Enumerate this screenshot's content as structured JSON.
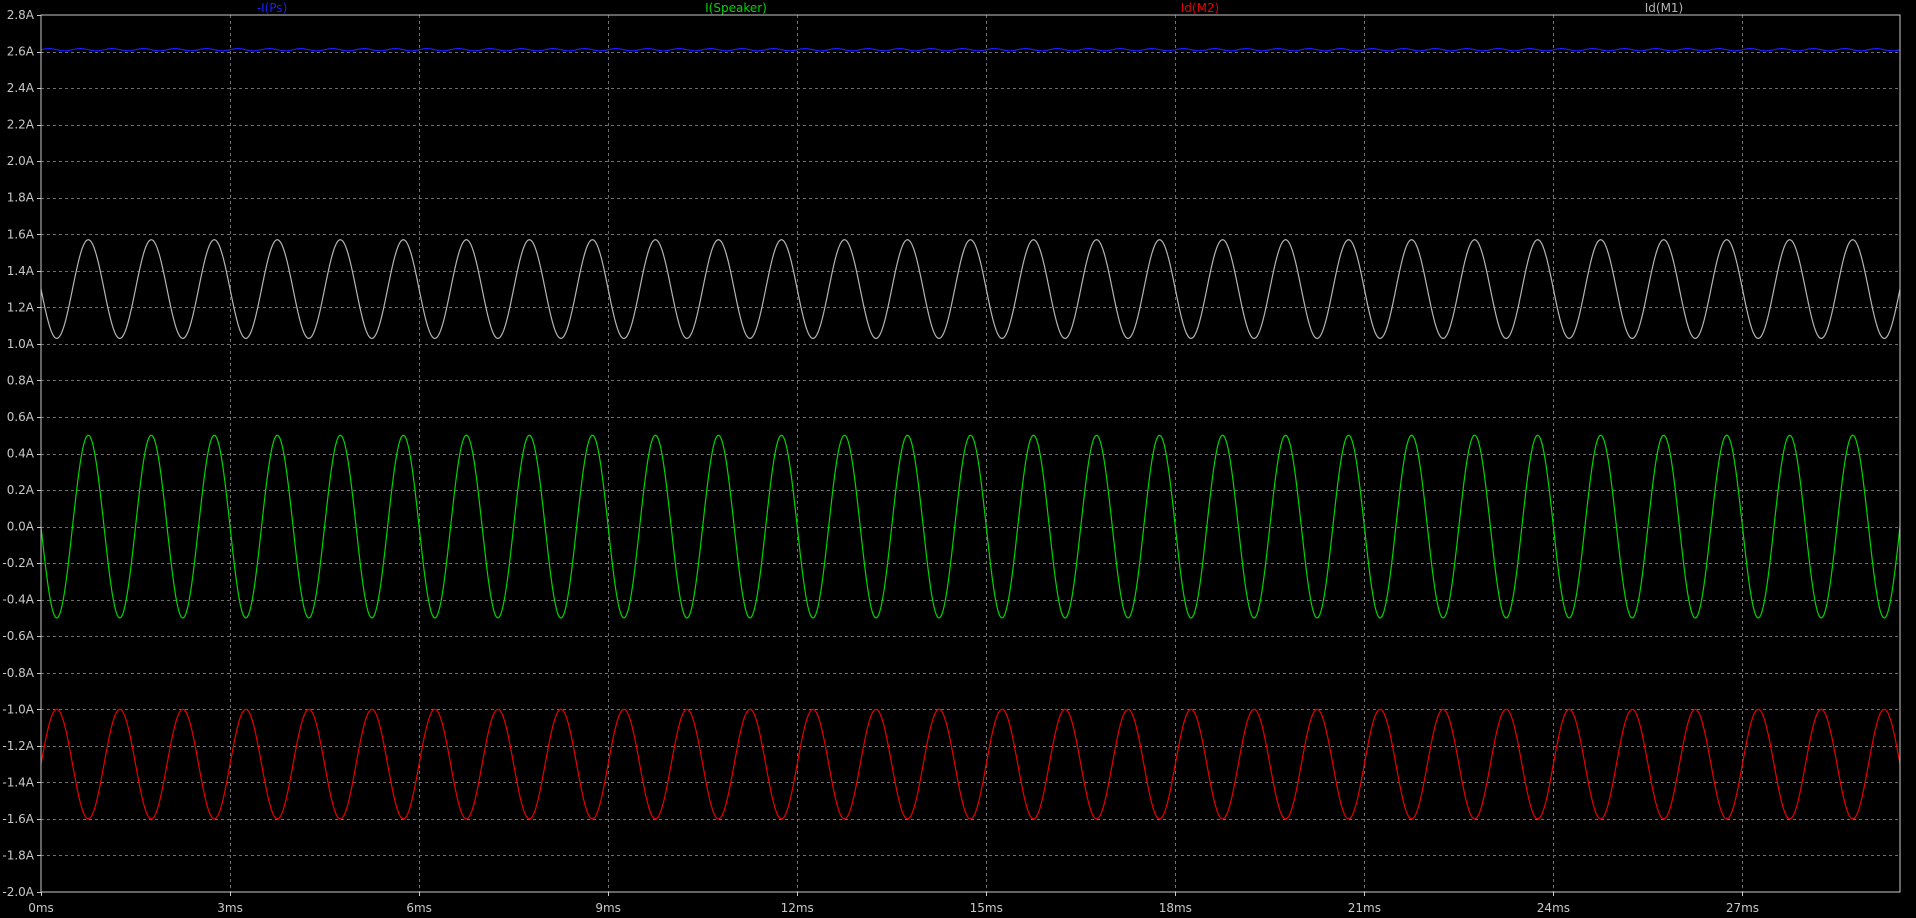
{
  "chart_data": {
    "type": "line",
    "title": "",
    "xlabel": "",
    "ylabel": "",
    "x_unit": "ms",
    "y_unit": "A",
    "xlim": [
      0,
      29.5
    ],
    "ylim": [
      -2.0,
      2.8
    ],
    "grid": true,
    "legend_placement": "top",
    "background_color": "#000000",
    "grid_color": "#6e6e6e",
    "axis_color": "#c8c8c8",
    "x_ticks": [
      {
        "value": 0,
        "label": "0ms"
      },
      {
        "value": 3,
        "label": "3ms"
      },
      {
        "value": 6,
        "label": "6ms"
      },
      {
        "value": 9,
        "label": "9ms"
      },
      {
        "value": 12,
        "label": "12ms"
      },
      {
        "value": 15,
        "label": "15ms"
      },
      {
        "value": 18,
        "label": "18ms"
      },
      {
        "value": 21,
        "label": "21ms"
      },
      {
        "value": 24,
        "label": "24ms"
      },
      {
        "value": 27,
        "label": "27ms"
      }
    ],
    "y_ticks": [
      {
        "value": 2.8,
        "label": "2.8A"
      },
      {
        "value": 2.6,
        "label": "2.6A"
      },
      {
        "value": 2.4,
        "label": "2.4A"
      },
      {
        "value": 2.2,
        "label": "2.2A"
      },
      {
        "value": 2.0,
        "label": "2.0A"
      },
      {
        "value": 1.8,
        "label": "1.8A"
      },
      {
        "value": 1.6,
        "label": "1.6A"
      },
      {
        "value": 1.4,
        "label": "1.4A"
      },
      {
        "value": 1.2,
        "label": "1.2A"
      },
      {
        "value": 1.0,
        "label": "1.0A"
      },
      {
        "value": 0.8,
        "label": "0.8A"
      },
      {
        "value": 0.6,
        "label": "0.6A"
      },
      {
        "value": 0.4,
        "label": "0.4A"
      },
      {
        "value": 0.2,
        "label": "0.2A"
      },
      {
        "value": 0.0,
        "label": "0.0A"
      },
      {
        "value": -0.2,
        "label": "-0.2A"
      },
      {
        "value": -0.4,
        "label": "-0.4A"
      },
      {
        "value": -0.6,
        "label": "-0.6A"
      },
      {
        "value": -0.8,
        "label": "-0.8A"
      },
      {
        "value": -1.0,
        "label": "-1.0A"
      },
      {
        "value": -1.2,
        "label": "-1.2A"
      },
      {
        "value": -1.4,
        "label": "-1.4A"
      },
      {
        "value": -1.6,
        "label": "-1.6A"
      },
      {
        "value": -1.8,
        "label": "-1.8A"
      },
      {
        "value": -2.0,
        "label": "-2.0A"
      }
    ],
    "series": [
      {
        "name": "-I(Ps)",
        "color": "#1e1eff",
        "waveform": "sine",
        "offset": 2.61,
        "amplitude": 0.006,
        "frequency_khz": 2.0,
        "phase_deg": 0
      },
      {
        "name": "I(Speaker)",
        "color": "#00d400",
        "waveform": "sine",
        "offset": 0.0,
        "amplitude": 0.5,
        "frequency_khz": 1.0,
        "phase_deg": 180
      },
      {
        "name": "Id(M2)",
        "color": "#e60000",
        "waveform": "sine",
        "offset": -1.3,
        "amplitude": 0.3,
        "frequency_khz": 1.0,
        "phase_deg": 0
      },
      {
        "name": "Id(M1)",
        "color": "#b4b4b4",
        "waveform": "sine",
        "offset": 1.3,
        "amplitude": 0.27,
        "frequency_khz": 1.0,
        "phase_deg": 180
      }
    ]
  }
}
